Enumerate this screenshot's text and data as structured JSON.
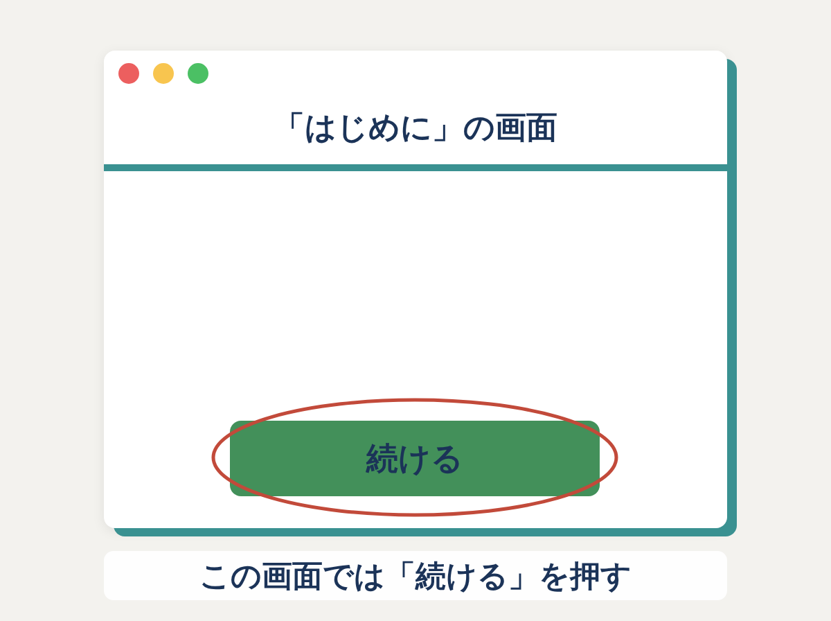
{
  "window": {
    "title": "「はじめに」の画面",
    "controls": [
      {
        "color": "#ec5f5f"
      },
      {
        "color": "#f8c54f"
      },
      {
        "color": "#4bc064"
      }
    ]
  },
  "button": {
    "label": "続ける",
    "highlighted": true
  },
  "caption": {
    "text": "この画面では「続ける」を押す"
  }
}
